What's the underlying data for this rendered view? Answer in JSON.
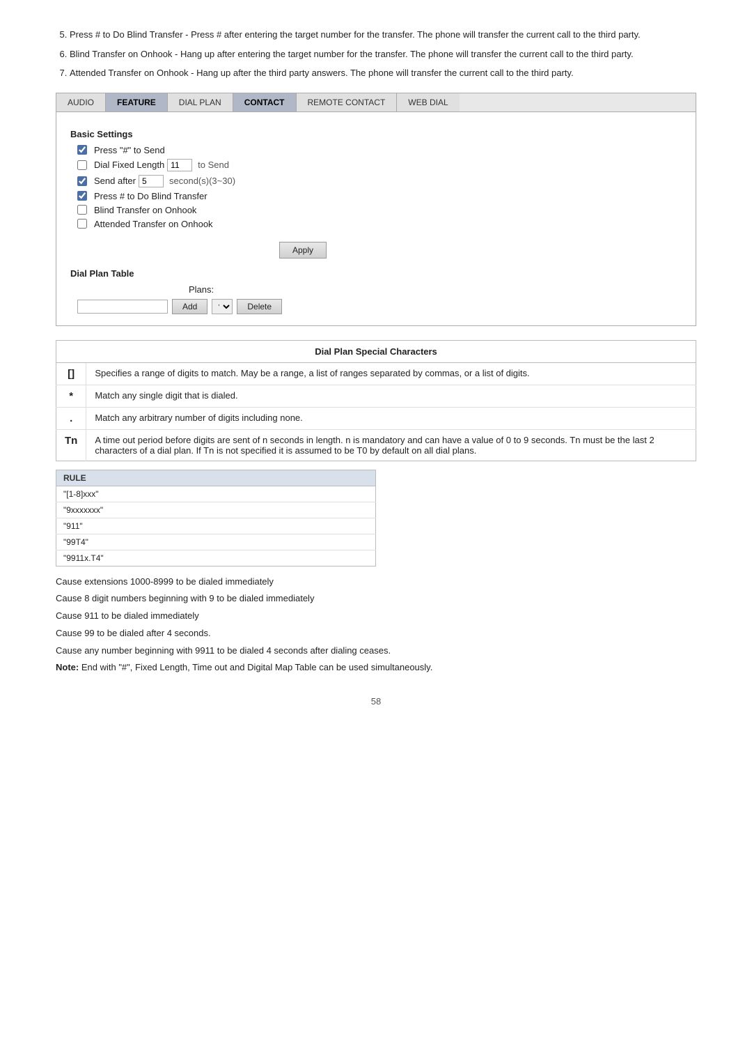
{
  "instructions": [
    {
      "number": 5,
      "text": "Press # to Do Blind Transfer - Press # after entering the target number for the transfer. The phone will transfer the current call to the third party."
    },
    {
      "number": 6,
      "text": "Blind Transfer on Onhook - Hang up after entering the target number for the transfer. The phone will transfer the current call to the third party."
    },
    {
      "number": 7,
      "text": "Attended Transfer on Onhook - Hang up after the third party answers. The phone will transfer the current call to the third party."
    }
  ],
  "tabs": [
    {
      "label": "AUDIO",
      "active": false
    },
    {
      "label": "FEATURE",
      "active": false
    },
    {
      "label": "DIAL PLAN",
      "active": false
    },
    {
      "label": "CONTACT",
      "active": true
    },
    {
      "label": "REMOTE CONTACT",
      "active": false
    },
    {
      "label": "WEB DIAL",
      "active": false
    }
  ],
  "basic_settings": {
    "title": "Basic Settings",
    "options": [
      {
        "id": "press_hash",
        "label": "Press \"#\" to Send",
        "checked": true
      },
      {
        "id": "dial_fixed",
        "label": "Dial Fixed Length",
        "checked": false,
        "has_input": true,
        "input_value": "11",
        "suffix": "to Send"
      },
      {
        "id": "send_after",
        "label": "Send after",
        "checked": true,
        "has_input": true,
        "input_value": "5",
        "suffix": "second(s)(3~30)"
      },
      {
        "id": "press_hash_blind",
        "label": "Press # to Do Blind Transfer",
        "checked": true
      },
      {
        "id": "blind_transfer_onhook",
        "label": "Blind Transfer on Onhook",
        "checked": false
      },
      {
        "id": "attended_transfer_onhook",
        "label": "Attended Transfer on Onhook",
        "checked": false
      }
    ],
    "apply_button": "Apply"
  },
  "dial_plan_table": {
    "title": "Dial Plan Table",
    "plans_label": "Plans:",
    "add_button": "Add",
    "delete_button": "Delete"
  },
  "special_chars": {
    "title": "Dial Plan Special Characters",
    "rows": [
      {
        "symbol": "[]",
        "description": "Specifies a range of digits to match. May be a range, a list of ranges separated by commas, or a list of digits."
      },
      {
        "symbol": "*",
        "description": "Match any single digit that is dialed."
      },
      {
        "symbol": ".",
        "description": "Match any arbitrary number of digits including none."
      },
      {
        "symbol": "Tn",
        "description": "A time out period before digits are sent of n seconds in length. n is mandatory and can have a value of 0 to 9 seconds. Tn must be the last 2 characters of a dial plan. If Tn is not specified it is assumed to be T0 by default on all dial plans."
      }
    ]
  },
  "rule_table": {
    "header": "RULE",
    "rows": [
      {
        "rule": "\"[1-8]xxx\""
      },
      {
        "rule": "\"9xxxxxxx\""
      },
      {
        "rule": "\"911\""
      },
      {
        "rule": "\"99T4\""
      },
      {
        "rule": "\"9911x.T4\""
      }
    ]
  },
  "explanations": [
    "Cause extensions 1000-8999 to be dialed immediately",
    "Cause 8 digit numbers beginning with 9 to be dialed immediately",
    "Cause 911 to be dialed immediately",
    "Cause 99 to be dialed after 4 seconds.",
    "Cause any number beginning with 9911 to be dialed 4 seconds after dialing ceases.",
    "Note: End with \"#\", Fixed Length, Time out and Digital Map Table can be used simultaneously."
  ],
  "page_number": "58"
}
